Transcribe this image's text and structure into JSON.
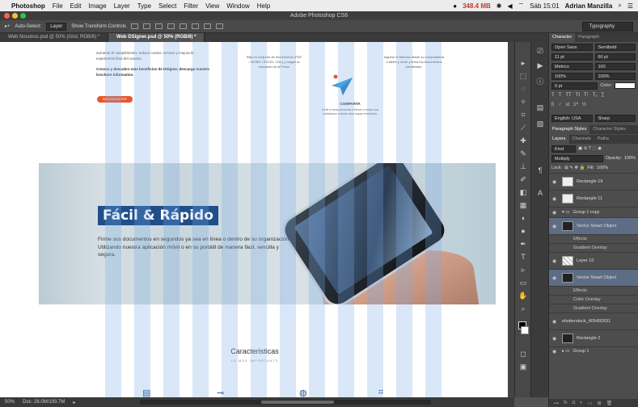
{
  "menubar": {
    "app": "Photoshop",
    "items": [
      "File",
      "Edit",
      "Image",
      "Layer",
      "Type",
      "Select",
      "Filter",
      "View",
      "Window",
      "Help"
    ],
    "memory": "348.4 MB",
    "clock": "Sáb 15:01",
    "user": "Adrian Manzilla"
  },
  "titlebar": {
    "title": "Adobe Photoshop CS6"
  },
  "options": {
    "auto_select": "Auto-Select:",
    "auto_select_value": "Layer",
    "transform_controls": "Show Transform Controls",
    "workspace": "Typography"
  },
  "tabs": [
    {
      "label": "Web Nosotros.psd @ 50% (Grid, RGB/8) *"
    },
    {
      "label": "Web DSigner.psd @ 50% (RGB/8) *"
    }
  ],
  "canvas": {
    "top_left_lines": [
      "aumento el cumplimiento, reduce costos, errores y mejora la",
      "experiencia final del usuario."
    ],
    "top_left_bold": "Conoce y descubre más beneficios de DSigner, descarga nuestro brochure informativo.",
    "brochure_button": "DESCARGAR PDF",
    "top_mid": "Elija un conjunto de documentos (PDF / WORD / EXCEL / Etc.) y asigne la ubicación de la Firma.",
    "top_right": "Ingrese el sistema desde su computadora o tablet y móvil y firma los documentos pendientes.",
    "comparta_title": "COMPARTA",
    "comparta_text": "Invite a otras personas a firmar y reciba una notificación cuando ellos hayan terminado.",
    "hero_title": "Fácil & Rápido",
    "hero_desc": "Firme sus documentos en segundos ya sea en línea o dentro de su organización. Utilizando nuestra aplicación móvil o en su portátil de manera fácil, sencilla y segura.",
    "features_title": "Caracteristicas",
    "features_sub": "LO MÁS IMPORTANTE"
  },
  "status": {
    "zoom": "50%",
    "doc": "Doc: 28.0M/193.7M"
  },
  "character": {
    "tabs": [
      "Character",
      "Paragraph"
    ],
    "font": "Open Sans",
    "style": "Semibold",
    "size": "11 pt",
    "leading": "60 pt",
    "kerning": "Metrics",
    "tracking": "100",
    "vscale": "100%",
    "hscale": "100%",
    "baseline": "0 pt",
    "color_label": "Color:",
    "language": "English: USA",
    "aa": "Sharp"
  },
  "styles_tabs": [
    "Paragraph Styles",
    "Character Styles"
  ],
  "layers_panel": {
    "tabs": [
      "Layers",
      "Channels",
      "Paths"
    ],
    "kind": "Kind",
    "blend": "Multiply",
    "opacity_label": "Opacity:",
    "opacity": "100%",
    "lock_label": "Lock:",
    "fill_label": "Fill:",
    "fill": "100%",
    "layers": [
      {
        "name": "Rectangle 19",
        "type": "shape",
        "sub": false
      },
      {
        "name": "Rectangle 11",
        "type": "shape",
        "sub": false
      },
      {
        "name": "Group 1 copy",
        "type": "group",
        "sub": false
      },
      {
        "name": "Vector Smart Object",
        "type": "smart",
        "sub": false,
        "selected": true
      },
      {
        "name": "Effects",
        "type": "fx",
        "sub": true
      },
      {
        "name": "Gradient Overlay",
        "type": "fx",
        "sub": true
      },
      {
        "name": "Layer 10",
        "type": "pixel",
        "sub": false
      },
      {
        "name": "Vector Smart Object",
        "type": "smart",
        "sub": false,
        "selected": true
      },
      {
        "name": "Effects",
        "type": "fx",
        "sub": true
      },
      {
        "name": "Color Overlay",
        "type": "fx",
        "sub": true
      },
      {
        "name": "Gradient Overlay",
        "type": "fx",
        "sub": true
      },
      {
        "name": "shutterstock_405492631",
        "type": "pixel",
        "sub": false
      },
      {
        "name": "Rectangle 2",
        "type": "shape",
        "sub": false
      },
      {
        "name": "Group 1",
        "type": "group",
        "sub": false
      }
    ]
  },
  "colors": {
    "accent": "#1f4e8a",
    "button": "#e8562c",
    "guides": "#78aae6"
  }
}
